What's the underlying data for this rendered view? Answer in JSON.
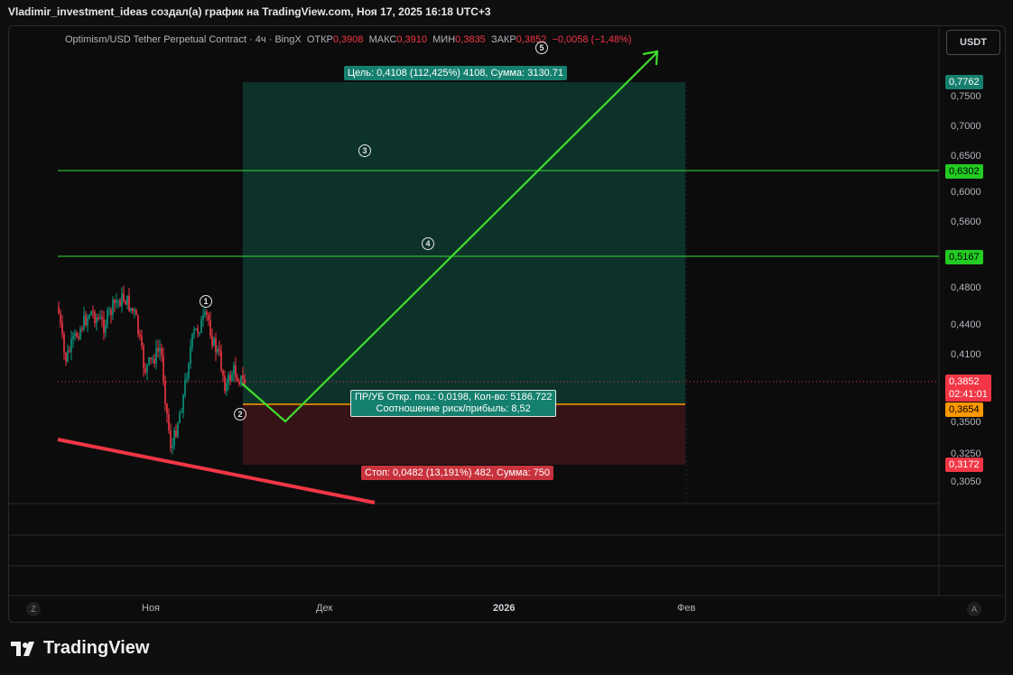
{
  "header": {
    "title": "Vladimir_investment_ideas создал(а) график на TradingView.com, Ноя 17, 2025 16:18 UTC+3"
  },
  "legend": {
    "symbol": "Optimism/USD Tether Perpetual Contract · 4ч · BingX",
    "open_label": "ОТКР",
    "open": "0,3908",
    "high_label": "МАКС",
    "high": "0,3910",
    "low_label": "МИН",
    "low": "0,3835",
    "close_label": "ЗАКР",
    "close": "0,3852",
    "change": "−0,0058 (−1,48%)"
  },
  "currency_button": "USDT",
  "target_label": "Цель: 0,4108 (112,425%) 4108, Сумма: 3130.71",
  "position_label_1": "ПР/УБ Откр. поз.: 0,0198, Кол-во: 5186.722",
  "position_label_2": "Соотношение риск/прибыль: 8,52",
  "stop_label": "Стоп: 0,0482 (13,191%) 482, Сумма: 750",
  "price_axis": [
    "0,7500",
    "0,7000",
    "0,6500",
    "0,6000",
    "0,5600",
    "0,4800",
    "0,4400",
    "0,4100",
    "0,3500",
    "0,3250",
    "0,3050"
  ],
  "price_tags": {
    "top": "0,7762",
    "level1": "0,6302",
    "level2": "0,5167",
    "current": "0,3852",
    "countdown": "02:41:01",
    "entry": "0,3654",
    "stop": "0,3172"
  },
  "time_axis": [
    "Ноя",
    "Дек",
    "2026",
    "Фев"
  ],
  "markers": [
    "1",
    "2",
    "3",
    "4",
    "5"
  ],
  "bottom_buttons": {
    "left": "Z",
    "right": "A"
  },
  "brand": "TradingView",
  "colors": {
    "up": "#089981",
    "down": "#f23645",
    "level": "#33e033",
    "arrow": "#3fdd2a",
    "trend": "#f23645"
  }
}
